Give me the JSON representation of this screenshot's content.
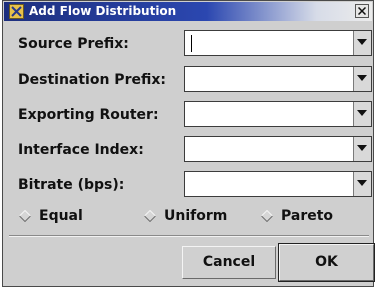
{
  "window": {
    "title": "Add Flow Distribution",
    "icon": "x-app-icon",
    "close_icon": "close-icon"
  },
  "fields": [
    {
      "label": "Source Prefix:",
      "value": "",
      "focused": true
    },
    {
      "label": "Destination Prefix:",
      "value": "",
      "focused": false
    },
    {
      "label": "Exporting Router:",
      "value": "",
      "focused": false
    },
    {
      "label": "Interface Index:",
      "value": "",
      "focused": false
    },
    {
      "label": "Bitrate (bps):",
      "value": "",
      "focused": false
    }
  ],
  "distribution": {
    "options": [
      "Equal",
      "Uniform",
      "Pareto"
    ],
    "selected": null
  },
  "buttons": {
    "cancel": "Cancel",
    "ok": "OK"
  },
  "colors": {
    "title_bar": "#1d2f7e",
    "dialog_bg": "#cfcfcf"
  }
}
